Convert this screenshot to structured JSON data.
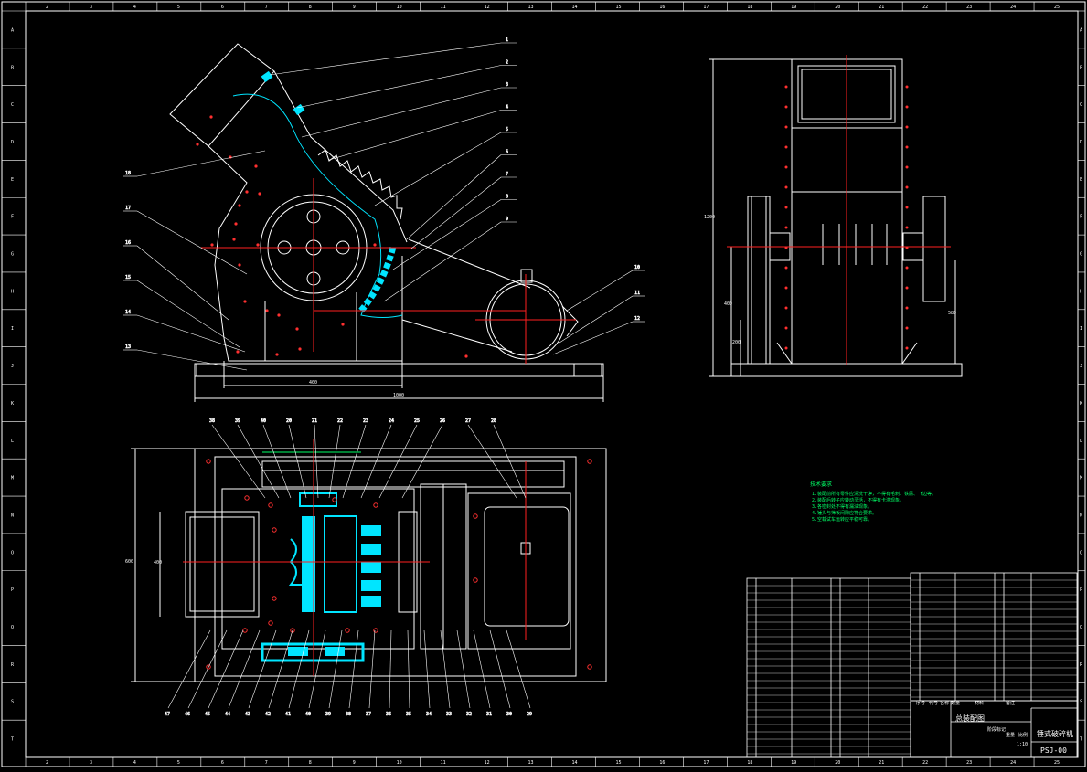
{
  "sheet": {
    "title": "",
    "drawing_number": "PSJ-00",
    "assembly_label": "总装配图",
    "part_label": "锤式破碎机"
  },
  "border": {
    "top_numbers": [
      "2",
      "3",
      "4",
      "5",
      "6",
      "7",
      "8",
      "9",
      "10",
      "11",
      "12",
      "13",
      "14",
      "15",
      "16",
      "17",
      "18",
      "19",
      "20",
      "21",
      "22",
      "23",
      "24",
      "25"
    ],
    "side_letters": [
      "A",
      "B",
      "C",
      "D",
      "E",
      "F",
      "G",
      "H",
      "I",
      "J",
      "K",
      "L",
      "M",
      "N",
      "O",
      "P",
      "Q",
      "R",
      "S",
      "T"
    ]
  },
  "front_view": {
    "callouts_right": [
      "1",
      "2",
      "3",
      "4",
      "5",
      "6",
      "7",
      "8",
      "9"
    ],
    "callouts_left": [
      "18",
      "17",
      "16",
      "15",
      "14",
      "13"
    ],
    "callouts_motor": [
      "10",
      "11",
      "12"
    ],
    "dim_width": "400",
    "dim_total": "1000"
  },
  "side_view": {
    "dim_height": "1200",
    "dim_a": "200",
    "dim_b": "400",
    "dim_c": "580"
  },
  "top_view": {
    "callouts_top": [
      "38",
      "39",
      "40",
      "20",
      "21",
      "22",
      "23",
      "24",
      "25",
      "26",
      "27",
      "28"
    ],
    "callouts_bottom": [
      "47",
      "46",
      "45",
      "44",
      "43",
      "42",
      "41",
      "40",
      "39",
      "38",
      "37",
      "36",
      "35",
      "34",
      "33",
      "32",
      "31",
      "30",
      "29"
    ],
    "dim_height": "600",
    "dim_inner": "400"
  },
  "notes": {
    "heading": "技术要求",
    "lines": [
      "1.装配前所有零件应清洗干净，不得有毛刺、铁屑、飞边等。",
      "2.装配后转子应转动灵活，不得有卡滞现象。",
      "3.各密封处不得有漏油现象。",
      "4.锤头与筛板间隙应符合要求。",
      "5.空载试车运转应平稳可靠。"
    ]
  },
  "title_block": {
    "headers": [
      "序号",
      "代号",
      "名称",
      "数量",
      "材料",
      "备注"
    ],
    "stage_label": "阶段标记",
    "weight_label": "重量",
    "scale_label": "比例",
    "scale_value": "1:10"
  }
}
